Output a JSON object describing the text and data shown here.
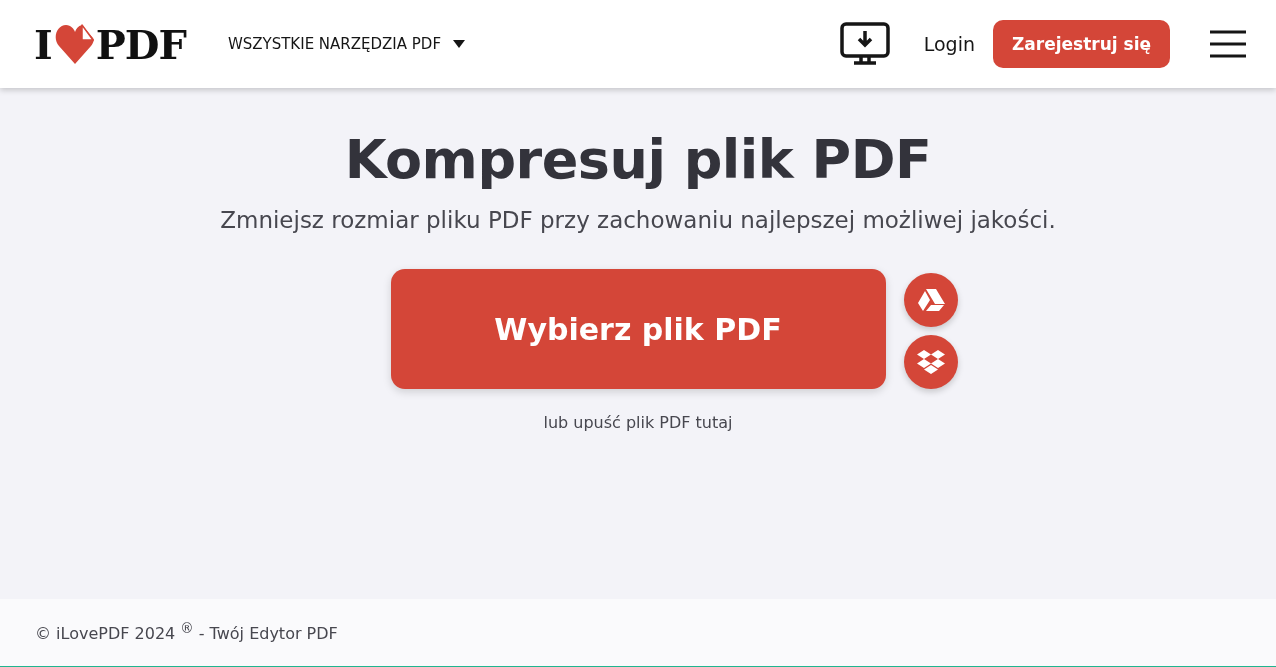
{
  "header": {
    "logo": {
      "left": "I",
      "right": "PDF"
    },
    "tools_menu": "WSZYSTKIE NARZĘDZIA PDF",
    "login": "Login",
    "register": "Zarejestruj się"
  },
  "main": {
    "title": "Kompresuj plik PDF",
    "subtitle": "Zmniejsz rozmiar pliku PDF przy zachowaniu najlepszej możliwej jakości.",
    "select_button": "Wybierz plik PDF",
    "drop_hint": "lub upuść plik PDF tutaj",
    "sources": [
      {
        "kind": "drive"
      },
      {
        "kind": "dropbox"
      }
    ]
  },
  "footer": {
    "text": "© iLovePDF 2024 $^{®}$ - Twój Edytor PDF"
  }
}
